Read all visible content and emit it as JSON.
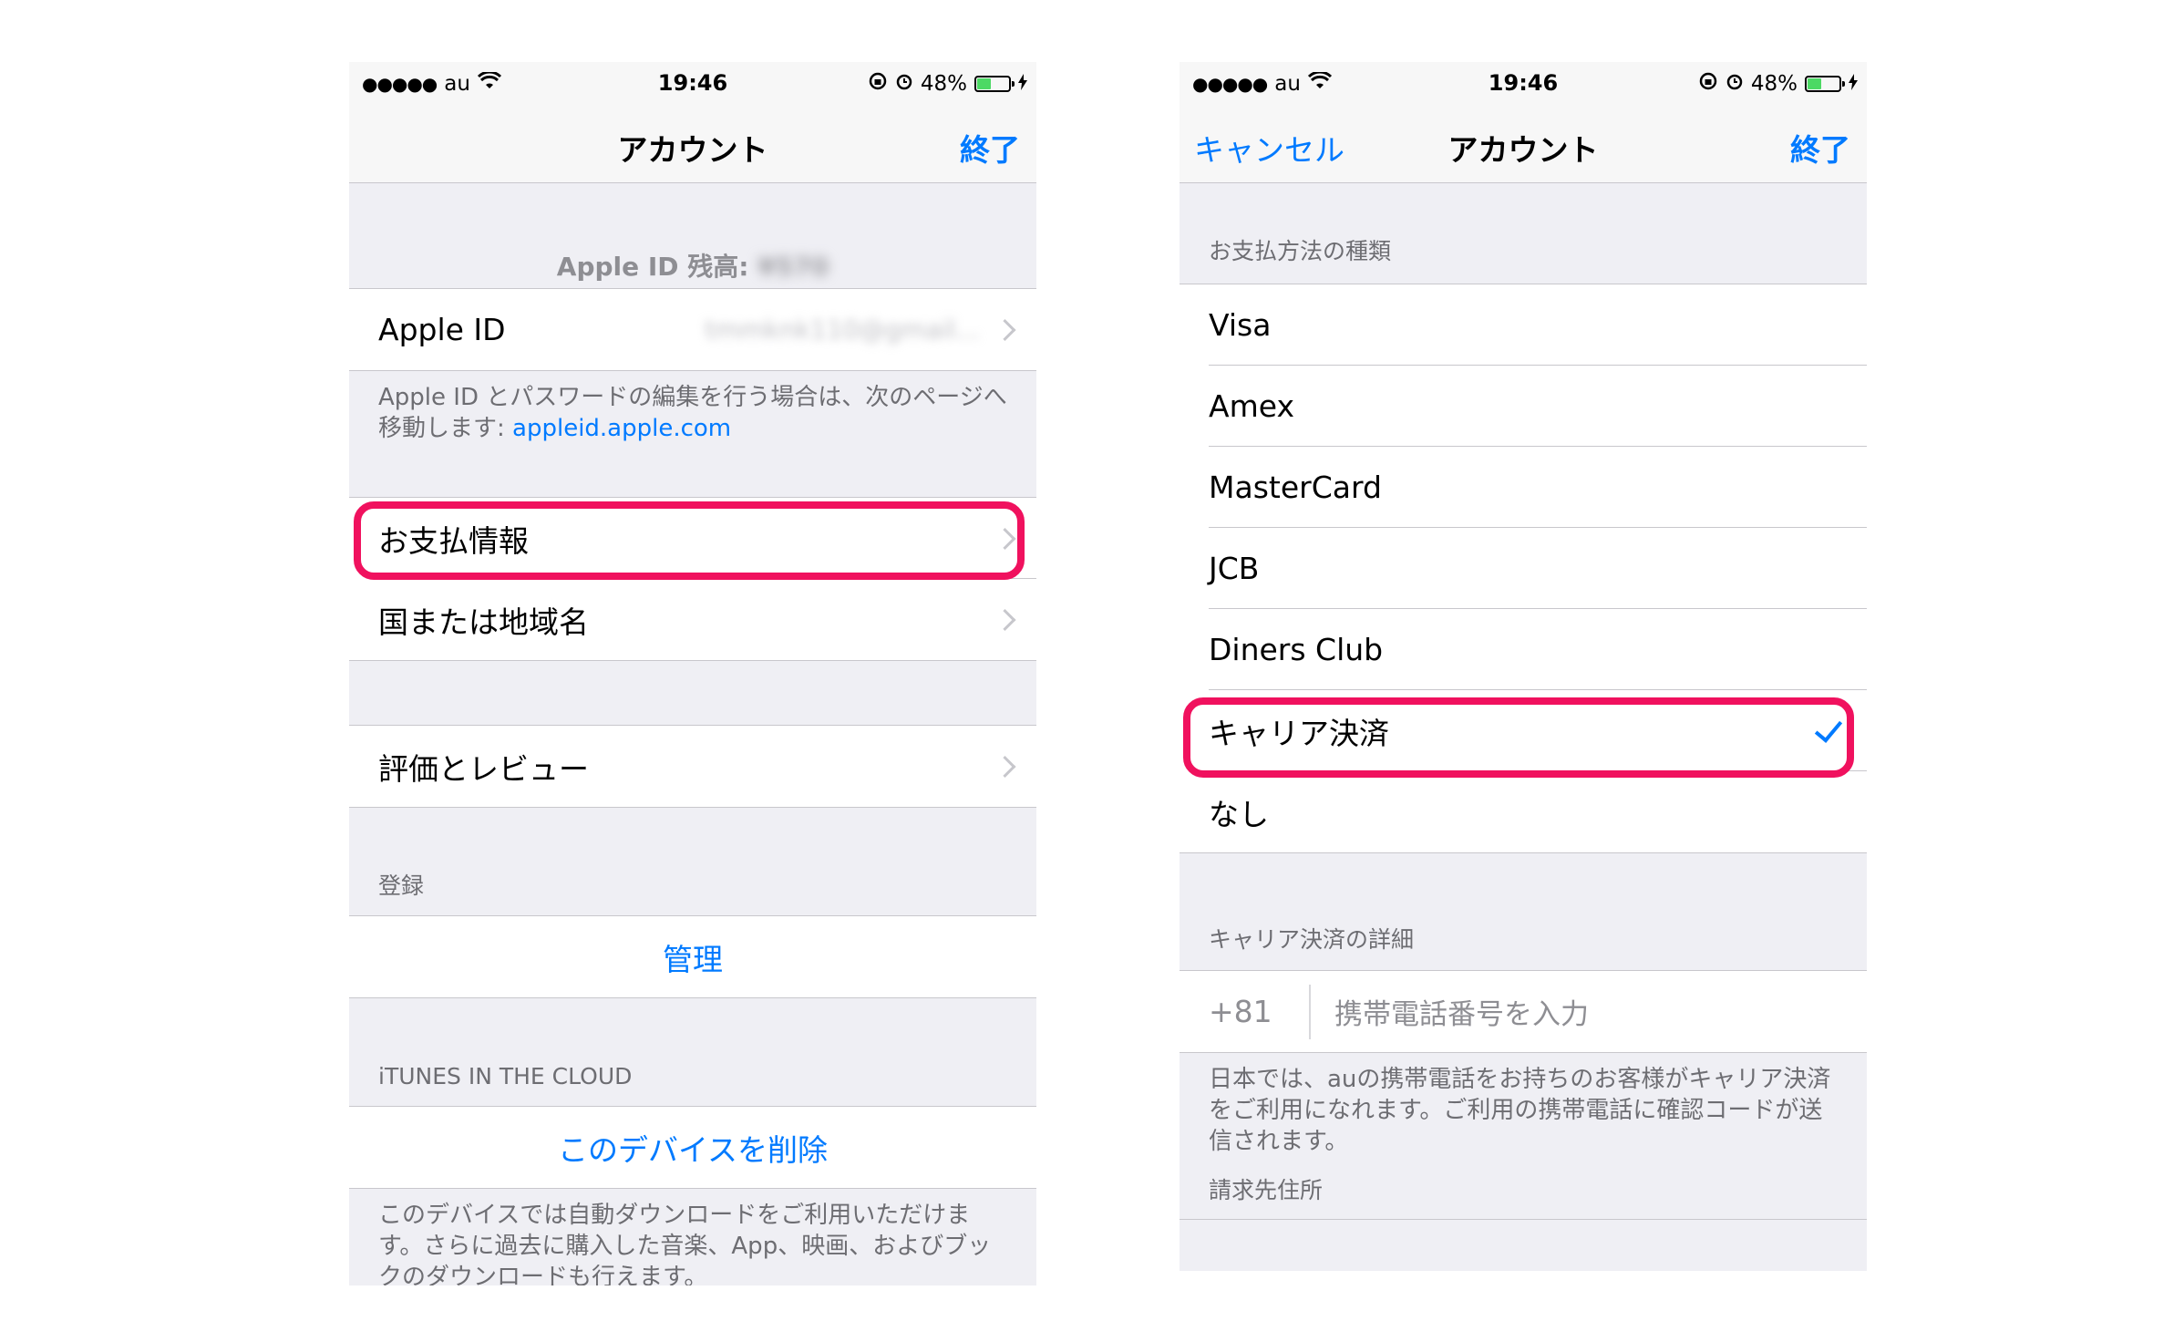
{
  "left": {
    "status": {
      "signal_dots": "●●●●●",
      "carrier": "au",
      "time": "19:46",
      "battery": "48%",
      "battery_level": 0.48
    },
    "nav": {
      "title": "アカウント",
      "done": "終了"
    },
    "balance": {
      "label": "Apple ID 残高:",
      "value": "¥570"
    },
    "apple_id": {
      "label": "Apple ID",
      "value": "tmmknk110@gmail..."
    },
    "apple_id_footer": {
      "text": "Apple ID とパスワードの編集を行う場合は、次のページへ移動します: ",
      "link": "appleid.apple.com"
    },
    "payment": {
      "label": "お支払情報"
    },
    "country": {
      "label": "国または地域名"
    },
    "ratings": {
      "label": "評価とレビュー"
    },
    "subscriptions": {
      "header": "登録",
      "manage": "管理"
    },
    "itunes_cloud": {
      "header": "iTUNES IN THE CLOUD",
      "remove": "このデバイスを削除",
      "footer": "このデバイスでは自動ダウンロードをご利用いただけます。さらに過去に購入した音楽、App、映画、およびブックのダウンロードも行えます。"
    }
  },
  "right": {
    "status": {
      "signal_dots": "●●●●●",
      "carrier": "au",
      "time": "19:46",
      "battery": "48%",
      "battery_level": 0.48
    },
    "nav": {
      "cancel": "キャンセル",
      "title": "アカウント",
      "done": "終了"
    },
    "payment_types": {
      "header": "お支払方法の種類",
      "items": [
        "Visa",
        "Amex",
        "MasterCard",
        "JCB",
        "Diners Club",
        "キャリア決済",
        "なし"
      ],
      "selected": "キャリア決済"
    },
    "carrier_details": {
      "header": "キャリア決済の詳細",
      "prefix": "+81",
      "placeholder": "携帯電話番号を入力",
      "footer": "日本では、auの携帯電話をお持ちのお客様がキャリア決済をご利用になれます。ご利用の携帯電話に確認コードが送信されます。"
    },
    "billing": {
      "header": "請求先住所"
    }
  },
  "colors": {
    "accent": "#007aff",
    "highlight": "#f0115e",
    "battery": "#4cd964"
  }
}
